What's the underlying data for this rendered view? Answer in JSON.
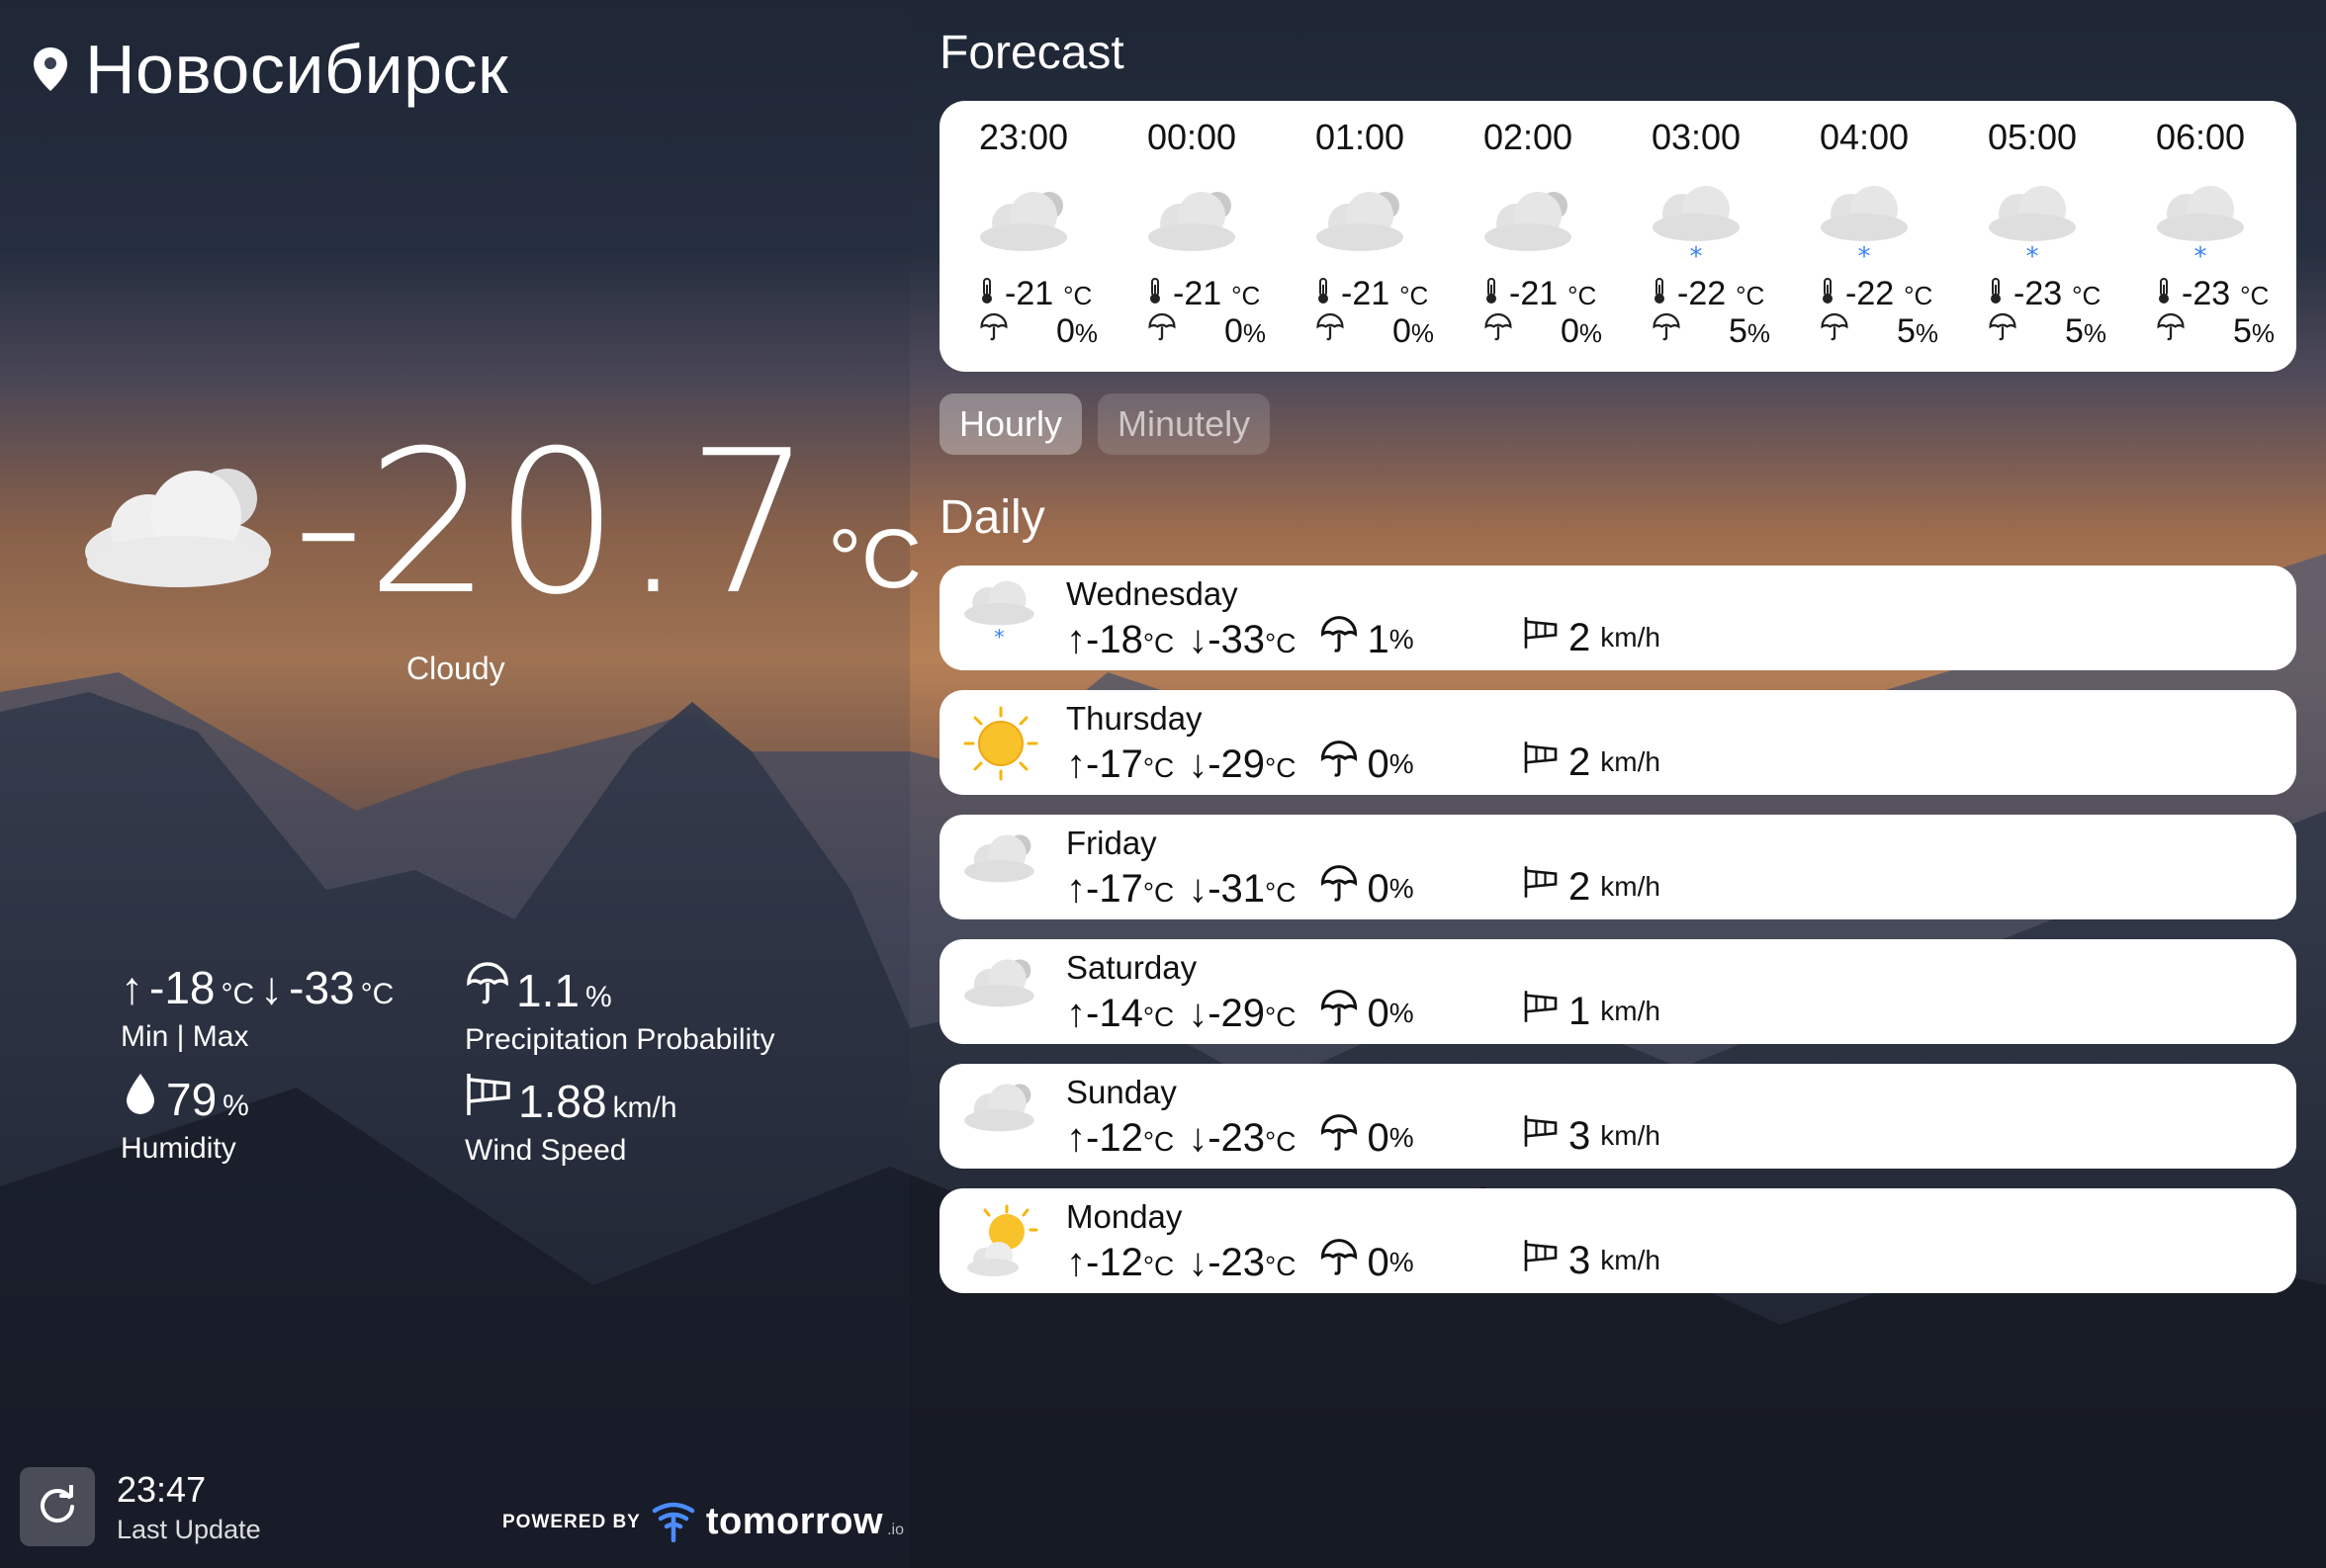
{
  "city": "Новосибирск",
  "current": {
    "temperature": "-20.7",
    "unit": "°C",
    "condition": "Cloudy",
    "icon": "cloudy-icon"
  },
  "stats": {
    "max": "-18",
    "min": "-33",
    "minmax_unit": "°C",
    "minmax_label": "Min | Max",
    "precipitation": "1.1",
    "precipitation_unit": "%",
    "precipitation_label": "Precipitation Probability",
    "humidity": "79",
    "humidity_unit": "%",
    "humidity_label": "Humidity",
    "wind": "1.88",
    "wind_unit": "km/h",
    "wind_label": "Wind Speed"
  },
  "last_update": {
    "time": "23:47",
    "label": "Last Update"
  },
  "powered": {
    "label": "POWERED BY",
    "brand": "tomorrow",
    "brand_suffix": ".io"
  },
  "forecast": {
    "title": "Forecast",
    "hourly": [
      {
        "time": "23:00",
        "icon": "cloudy-icon",
        "temp": "-21",
        "unit": "°C",
        "precip": "0",
        "precip_unit": "%"
      },
      {
        "time": "00:00",
        "icon": "cloudy-icon",
        "temp": "-21",
        "unit": "°C",
        "precip": "0",
        "precip_unit": "%"
      },
      {
        "time": "01:00",
        "icon": "cloudy-icon",
        "temp": "-21",
        "unit": "°C",
        "precip": "0",
        "precip_unit": "%"
      },
      {
        "time": "02:00",
        "icon": "cloudy-icon",
        "temp": "-21",
        "unit": "°C",
        "precip": "0",
        "precip_unit": "%"
      },
      {
        "time": "03:00",
        "icon": "light-snow-icon",
        "temp": "-22",
        "unit": "°C",
        "precip": "5",
        "precip_unit": "%"
      },
      {
        "time": "04:00",
        "icon": "light-snow-icon",
        "temp": "-22",
        "unit": "°C",
        "precip": "5",
        "precip_unit": "%"
      },
      {
        "time": "05:00",
        "icon": "light-snow-icon",
        "temp": "-23",
        "unit": "°C",
        "precip": "5",
        "precip_unit": "%"
      },
      {
        "time": "06:00",
        "icon": "light-snow-icon",
        "temp": "-23",
        "unit": "°C",
        "precip": "5",
        "precip_unit": "%"
      }
    ],
    "tabs": [
      {
        "label": "Hourly",
        "active": true
      },
      {
        "label": "Minutely",
        "active": false
      }
    ]
  },
  "daily": {
    "title": "Daily",
    "days": [
      {
        "name": "Wednesday",
        "icon": "light-snow-icon",
        "max": "-18",
        "min": "-33",
        "unit": "°C",
        "precip": "1",
        "precip_unit": "%",
        "wind": "2",
        "wind_unit": "km/h"
      },
      {
        "name": "Thursday",
        "icon": "sunny-icon",
        "max": "-17",
        "min": "-29",
        "unit": "°C",
        "precip": "0",
        "precip_unit": "%",
        "wind": "2",
        "wind_unit": "km/h"
      },
      {
        "name": "Friday",
        "icon": "cloudy-icon",
        "max": "-17",
        "min": "-31",
        "unit": "°C",
        "precip": "0",
        "precip_unit": "%",
        "wind": "2",
        "wind_unit": "km/h"
      },
      {
        "name": "Saturday",
        "icon": "cloudy-icon",
        "max": "-14",
        "min": "-29",
        "unit": "°C",
        "precip": "0",
        "precip_unit": "%",
        "wind": "1",
        "wind_unit": "km/h"
      },
      {
        "name": "Sunday",
        "icon": "cloudy-icon",
        "max": "-12",
        "min": "-23",
        "unit": "°C",
        "precip": "0",
        "precip_unit": "%",
        "wind": "3",
        "wind_unit": "km/h"
      },
      {
        "name": "Monday",
        "icon": "partly-cloudy-icon",
        "max": "-12",
        "min": "-23",
        "unit": "°C",
        "precip": "0",
        "precip_unit": "%",
        "wind": "3",
        "wind_unit": "km/h"
      }
    ]
  }
}
